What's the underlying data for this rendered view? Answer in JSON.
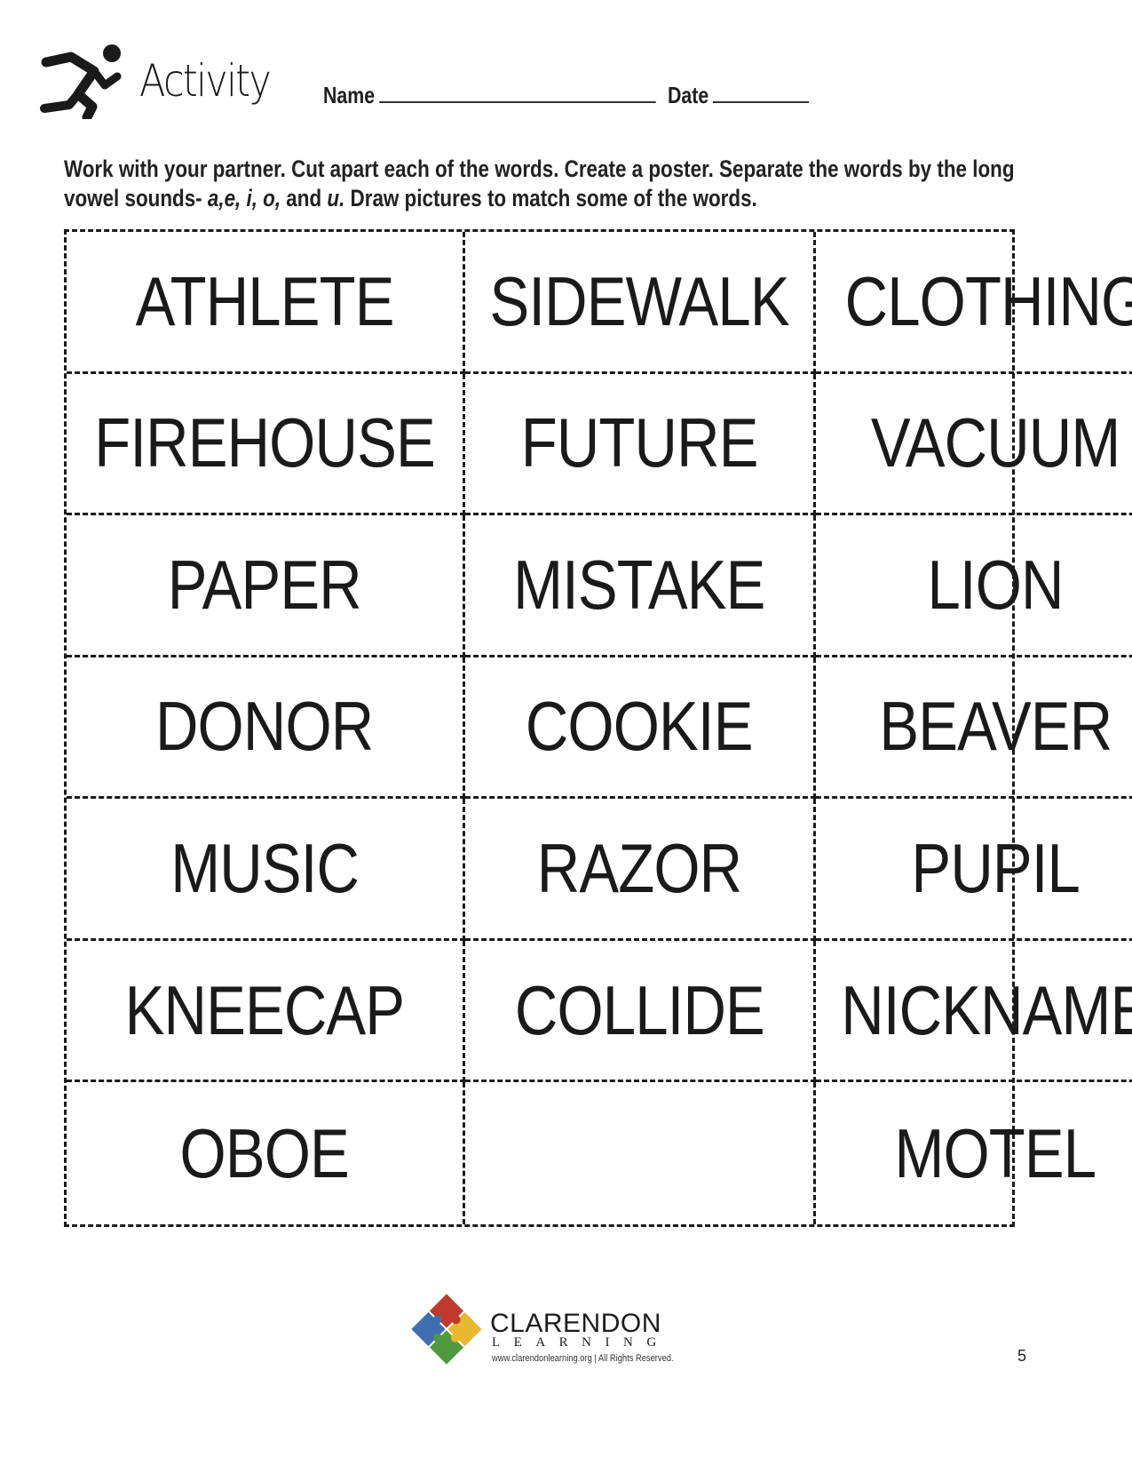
{
  "header": {
    "icon": "running-person-icon",
    "title": "Activity",
    "name_label": "Name",
    "date_label": "Date"
  },
  "instructions": {
    "part1": "Work with your partner. Cut apart each of the words. Create a poster. Separate the words by the long vowel sounds- ",
    "vowels_1": "a,e, i, o,",
    "part2": " and ",
    "vowels_2": "u.",
    "part3": " Draw pictures to match some of the words."
  },
  "words": [
    "ATHLETE",
    "SIDEWALK",
    "CLOTHING",
    "FIREHOUSE",
    "FUTURE",
    "VACUUM",
    "PAPER",
    "MISTAKE",
    "LION",
    "DONOR",
    "COOKIE",
    "BEAVER",
    "MUSIC",
    "RAZOR",
    "PUPIL",
    "KNEECAP",
    "COLLIDE",
    "NICKNAME",
    "OBOE",
    "",
    "MOTEL"
  ],
  "footer": {
    "brand": "CLARENDON",
    "brand_sub": "LEARNING",
    "url_text": "www.clarendonlearning.org | All Rights Reserved.",
    "logo_colors": [
      "#c0392b",
      "#e8b92e",
      "#4f9a3e",
      "#3d6fb0"
    ],
    "page_number": "5"
  }
}
